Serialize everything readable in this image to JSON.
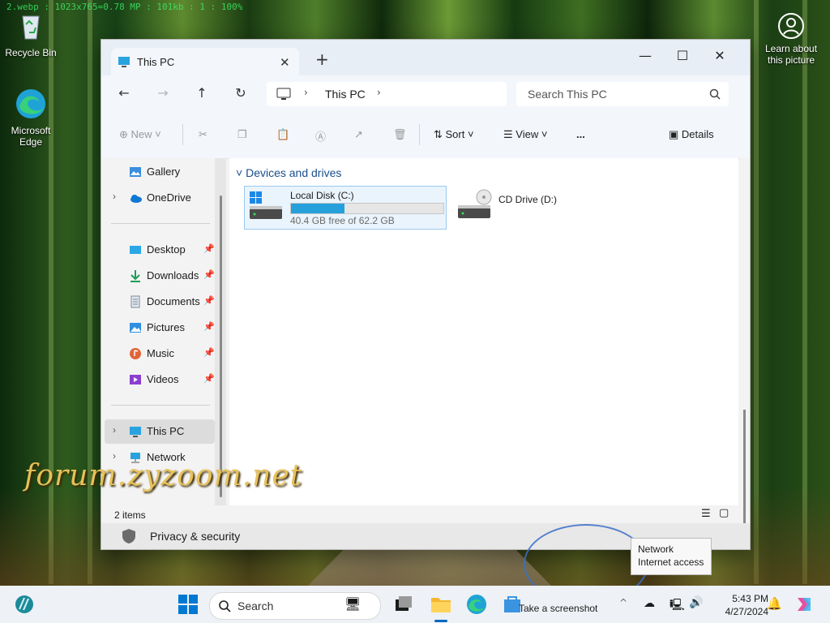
{
  "debug_overlay": "2.webp : 1023x765=0.78 MP : 101kb : 1 : 100%",
  "desktop": {
    "icons": [
      {
        "label": "Recycle Bin"
      },
      {
        "label": "Microsoft Edge"
      }
    ],
    "learn_about_picture": "Learn about this picture",
    "watermark": "forum.zyzoom.net"
  },
  "window": {
    "tab_title": "This PC",
    "breadcrumb": "This PC",
    "search_placeholder": "Search This PC",
    "toolbar": {
      "new": "New",
      "sort": "Sort",
      "view": "View",
      "more": "...",
      "details": "Details"
    },
    "sidebar": {
      "top_items": [
        {
          "label": "Gallery"
        },
        {
          "label": "OneDrive"
        }
      ],
      "pinned_items": [
        {
          "label": "Desktop"
        },
        {
          "label": "Downloads"
        },
        {
          "label": "Documents"
        },
        {
          "label": "Pictures"
        },
        {
          "label": "Music"
        },
        {
          "label": "Videos"
        }
      ],
      "bottom_items": [
        {
          "label": "This PC",
          "selected": true
        },
        {
          "label": "Network"
        }
      ]
    },
    "section_title": "Devices and drives",
    "drives": [
      {
        "name": "Local Disk (C:)",
        "free_text": "40.4 GB free of 62.2 GB",
        "used_fraction": 0.35
      },
      {
        "name": "CD Drive (D:)"
      }
    ],
    "status": "2 items",
    "settings_strip": "Privacy & security"
  },
  "tooltip": {
    "line1": "Network",
    "line2": "Internet access"
  },
  "taskbar": {
    "search_placeholder": "Search",
    "screenshot_label": "Take a screenshot",
    "time": "5:43 PM",
    "date": "4/27/2024"
  },
  "colors": {
    "accent": "#0067c0",
    "drive_bar": "#26a0da",
    "section_title": "#1a4d8c",
    "watermark": "#e7c15a"
  }
}
